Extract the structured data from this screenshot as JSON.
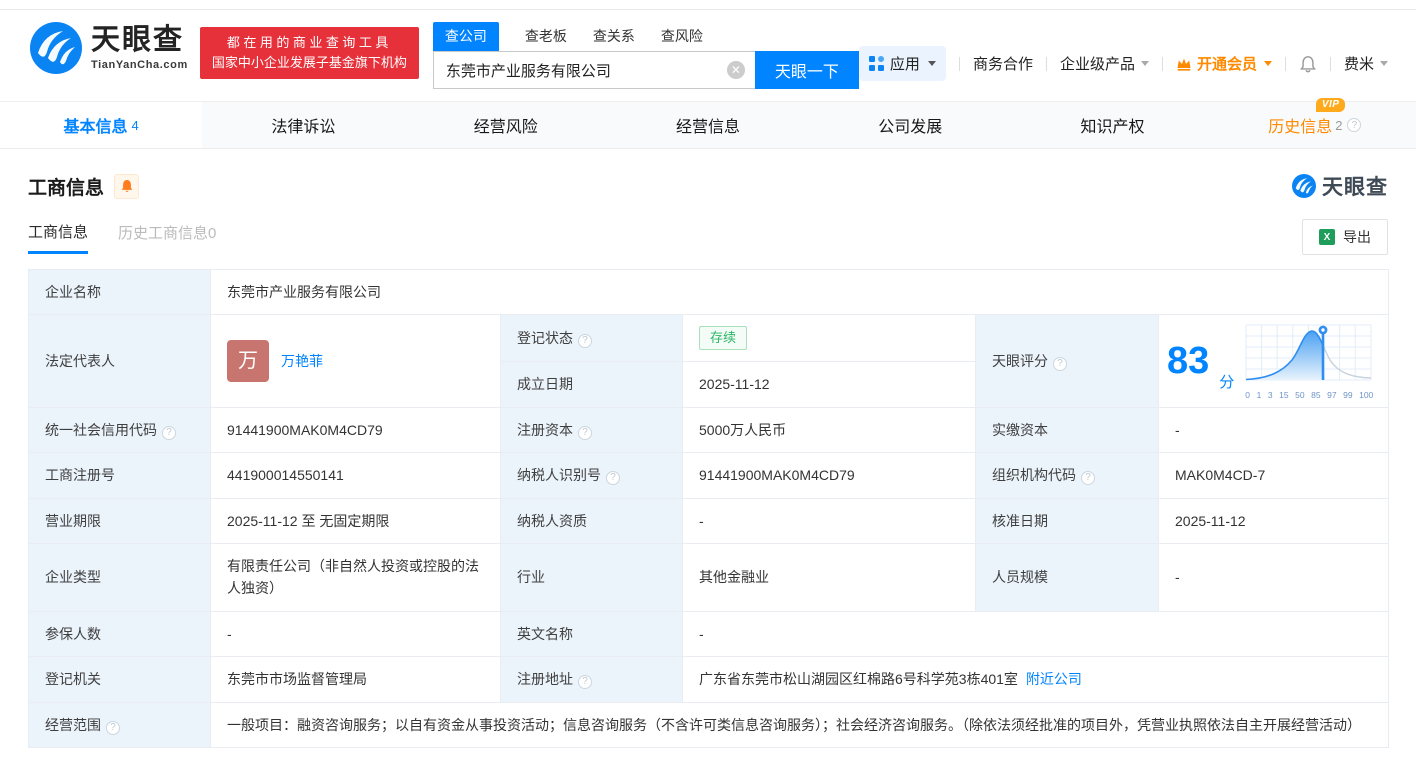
{
  "header": {
    "logo": {
      "brand": "天眼查",
      "domain": "TianYanCha.com"
    },
    "slogan": {
      "line1": "都在用的商业查询工具",
      "line2": "国家中小企业发展子基金旗下机构"
    },
    "search": {
      "tabs": [
        {
          "label": "查公司",
          "active": true
        },
        {
          "label": "查老板",
          "active": false
        },
        {
          "label": "查关系",
          "active": false
        },
        {
          "label": "查风险",
          "active": false
        }
      ],
      "value": "东莞市产业服务有限公司",
      "button": "天眼一下"
    },
    "nav": {
      "apps": "应用",
      "biz_coop": "商务合作",
      "enterprise": "企业级产品",
      "vip": "开通会员",
      "user": "费米"
    }
  },
  "vip_badge": "VIP",
  "tabs": [
    {
      "label": "基本信息",
      "count": "4",
      "active": true
    },
    {
      "label": "法律诉讼"
    },
    {
      "label": "经营风险"
    },
    {
      "label": "经营信息"
    },
    {
      "label": "公司发展"
    },
    {
      "label": "知识产权"
    },
    {
      "label": "历史信息",
      "count": "2",
      "vip": true
    }
  ],
  "section": {
    "title": "工商信息",
    "watermark": "天眼查",
    "subtabs": [
      {
        "label": "工商信息",
        "active": true
      },
      {
        "label": "历史工商信息0",
        "active": false
      }
    ],
    "export": "导出"
  },
  "biz": {
    "name": {
      "label": "企业名称",
      "value": "东莞市产业服务有限公司"
    },
    "legal": {
      "label": "法定代表人",
      "avatar": "万",
      "name": "万艳菲"
    },
    "status": {
      "label": "登记状态",
      "value": "存续"
    },
    "est": {
      "label": "成立日期",
      "value": "2025-11-12"
    },
    "score": {
      "label": "天眼评分",
      "value": "83",
      "unit": "分"
    },
    "credit": {
      "label": "统一社会信用代码",
      "value": "91441900MAK0M4CD79"
    },
    "regcap": {
      "label": "注册资本",
      "value": "5000万人民币"
    },
    "paidcap": {
      "label": "实缴资本",
      "value": "-"
    },
    "regno": {
      "label": "工商注册号",
      "value": "441900014550141"
    },
    "taxno": {
      "label": "纳税人识别号",
      "value": "91441900MAK0M4CD79"
    },
    "orgcode": {
      "label": "组织机构代码",
      "value": "MAK0M4CD-7"
    },
    "term": {
      "label": "营业期限",
      "value": "2025-11-12 至 无固定期限"
    },
    "taxqual": {
      "label": "纳税人资质",
      "value": "-"
    },
    "approval": {
      "label": "核准日期",
      "value": "2025-11-12"
    },
    "type": {
      "label": "企业类型",
      "value": "有限责任公司（非自然人投资或控股的法人独资）"
    },
    "industry": {
      "label": "行业",
      "value": "其他金融业"
    },
    "staff": {
      "label": "人员规模",
      "value": "-"
    },
    "insured": {
      "label": "参保人数",
      "value": "-"
    },
    "engname": {
      "label": "英文名称",
      "value": "-"
    },
    "authority": {
      "label": "登记机关",
      "value": "东莞市市场监督管理局"
    },
    "address": {
      "label": "注册地址",
      "value": "广东省东莞市松山湖园区红棉路6号科学苑3栋401室",
      "link": "附近公司"
    },
    "scope": {
      "label": "经营范围",
      "value": "一般项目：融资咨询服务；以自有资金从事投资活动；信息咨询服务（不含许可类信息咨询服务）；社会经济咨询服务。（除依法须经批准的项目外，凭营业执照依法自主开展经营活动）"
    }
  },
  "chart_data": {
    "type": "area",
    "title": "天眼评分",
    "score": 83,
    "score_unit": "分",
    "x_ticks": [
      "0",
      "1",
      "3",
      "15",
      "50",
      "85",
      "97",
      "99",
      "100"
    ],
    "marker_value": 83,
    "description": "天眼评分分布钟形曲线，标记点位于公司评分83处",
    "accent_color": "#2f8ef0"
  },
  "colors": {
    "brand_blue": "#0084ff",
    "banner_red": "#e6303a",
    "vip_orange": "#ff8a00",
    "status_green": "#2bb566",
    "label_cell_bg": "#ebf3fb",
    "avatar_bg": "#c87570"
  }
}
